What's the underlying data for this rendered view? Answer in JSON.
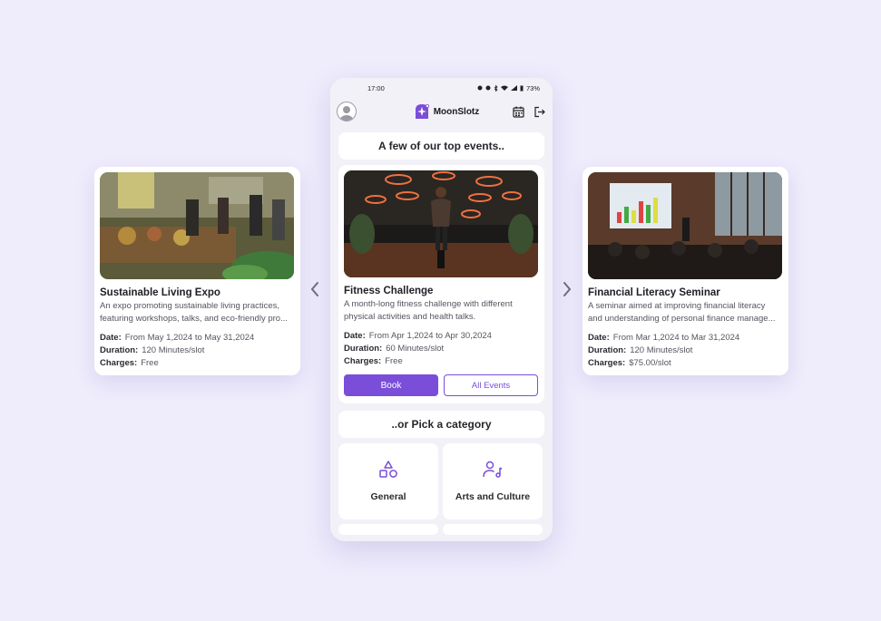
{
  "phone": {
    "status": {
      "time": "17:00",
      "battery": "73%"
    },
    "brand": "MoonSlotz",
    "top_events_heading": "A few of our top events..",
    "category_heading": "..or Pick a category",
    "featured": {
      "title": "Fitness Challenge",
      "desc_line1": "A month-long fitness challenge with different",
      "desc_line2": "physical activities and health talks.",
      "date_label": "Date:",
      "date_value": "From Apr 1,2024 to Apr 30,2024",
      "duration_label": "Duration:",
      "duration_value": "60 Minutes/slot",
      "charges_label": "Charges:",
      "charges_value": "Free",
      "book_label": "Book",
      "all_events_label": "All Events"
    },
    "categories": [
      {
        "label": "General",
        "icon": "shapes-icon"
      },
      {
        "label": "Arts and Culture",
        "icon": "music-person-icon"
      }
    ]
  },
  "left_card": {
    "title": "Sustainable Living Expo",
    "desc_line1": "An expo promoting sustainable living practices,",
    "desc_line2": "featuring workshops, talks, and eco-friendly pro...",
    "date_label": "Date:",
    "date_value": "From May 1,2024 to May 31,2024",
    "duration_label": "Duration:",
    "duration_value": "120 Minutes/slot",
    "charges_label": "Charges:",
    "charges_value": "Free"
  },
  "right_card": {
    "title": "Financial Literacy Seminar",
    "desc_line1": "A seminar aimed at improving financial literacy",
    "desc_line2": "and understanding of personal finance manage...",
    "date_label": "Date:",
    "date_value": "From Mar 1,2024 to Mar 31,2024",
    "duration_label": "Duration:",
    "duration_value": "120 Minutes/slot",
    "charges_label": "Charges:",
    "charges_value": "$75.00/slot"
  },
  "nav": {
    "prev_icon": "chevron-left-icon",
    "next_icon": "chevron-right-icon"
  },
  "colors": {
    "accent": "#7a4ed8",
    "background": "#efecfc"
  }
}
